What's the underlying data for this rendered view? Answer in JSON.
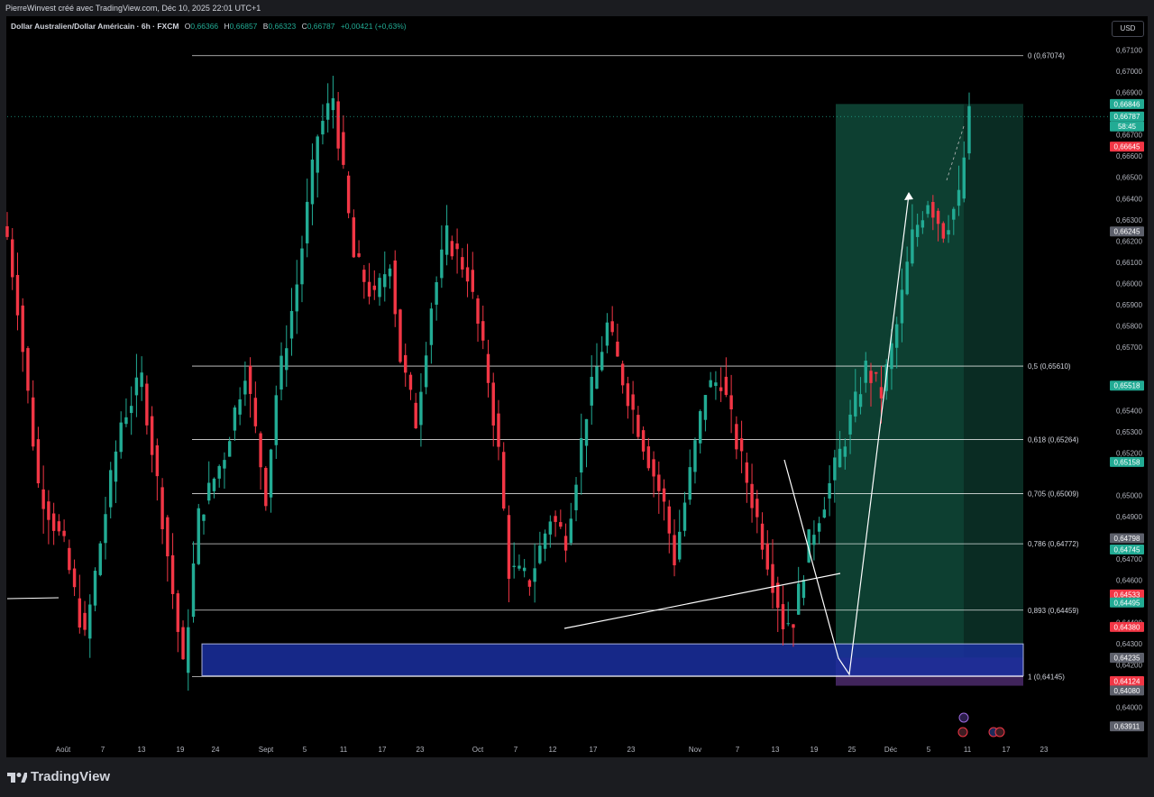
{
  "header": {
    "credit": "PierreWinvest créé avec TradingView.com, Déc 10, 2025 22:01 UTC+1"
  },
  "legend": {
    "symbol": "Dollar Australien/Dollar Américain · 6h · FXCM",
    "o_label": "O",
    "o": "0,66366",
    "h_label": "H",
    "h": "0,66857",
    "b_label": "B",
    "b": "0,66323",
    "c_label": "C",
    "c": "0,66787",
    "change": "+0,00421 (+0,63%)"
  },
  "currency_button": "USD",
  "brand": {
    "name": "TradingView"
  },
  "colors": {
    "up": "#22ab94",
    "down": "#f23645",
    "fib": "#ffffff",
    "zone_blue": "#1a2fa0",
    "profit": "#0f4a3a"
  },
  "chart_data": {
    "type": "candlestick",
    "symbol": "AUD/USD",
    "timeframe": "6h",
    "ylim": [
      0.6385,
      0.6726
    ],
    "y_ticks": [
      "0,67100",
      "0,67000",
      "0,66900",
      "0,66700",
      "0,66600",
      "0,66500",
      "0,66400",
      "0,66300",
      "0,66200",
      "0,66100",
      "0,66000",
      "0,65900",
      "0,65800",
      "0,65700",
      "0,65400",
      "0,65300",
      "0,65200",
      "0,65000",
      "0,64900",
      "0,64700",
      "0,64600",
      "0,64400",
      "0,64300",
      "0,64200",
      "0,64000"
    ],
    "x_ticks": [
      "Août",
      "7",
      "13",
      "19",
      "24",
      "Sept",
      "5",
      "11",
      "17",
      "23",
      "Oct",
      "7",
      "12",
      "17",
      "23",
      "Nov",
      "7",
      "13",
      "19",
      "25",
      "Déc",
      "5",
      "11",
      "17",
      "23"
    ],
    "price_path": [
      [
        0,
        0.6622
      ],
      [
        2,
        0.659
      ],
      [
        6,
        0.6505
      ],
      [
        11,
        0.6475
      ],
      [
        15,
        0.6432
      ],
      [
        18,
        0.6478
      ],
      [
        22,
        0.6535
      ],
      [
        26,
        0.6555
      ],
      [
        30,
        0.649
      ],
      [
        34,
        0.6418
      ],
      [
        37,
        0.649
      ],
      [
        42,
        0.652
      ],
      [
        46,
        0.656
      ],
      [
        50,
        0.65
      ],
      [
        52,
        0.6548
      ],
      [
        56,
        0.66
      ],
      [
        60,
        0.667
      ],
      [
        63,
        0.6688
      ],
      [
        67,
        0.6612
      ],
      [
        71,
        0.6592
      ],
      [
        74,
        0.6612
      ],
      [
        76,
        0.6565
      ],
      [
        79,
        0.6535
      ],
      [
        82,
        0.659
      ],
      [
        85,
        0.6622
      ],
      [
        89,
        0.6605
      ],
      [
        93,
        0.6555
      ],
      [
        95,
        0.652
      ],
      [
        97,
        0.6465
      ],
      [
        101,
        0.646
      ],
      [
        105,
        0.649
      ],
      [
        108,
        0.648
      ],
      [
        112,
        0.654
      ],
      [
        116,
        0.658
      ],
      [
        119,
        0.6555
      ],
      [
        123,
        0.6525
      ],
      [
        127,
        0.6495
      ],
      [
        129,
        0.647
      ],
      [
        132,
        0.651
      ],
      [
        135,
        0.655
      ],
      [
        138,
        0.6555
      ],
      [
        141,
        0.6525
      ],
      [
        144,
        0.6498
      ],
      [
        147,
        0.647
      ],
      [
        150,
        0.644
      ],
      [
        152,
        0.6442
      ],
      [
        155,
        0.6478
      ],
      [
        159,
        0.6505
      ],
      [
        163,
        0.6535
      ],
      [
        166,
        0.656
      ],
      [
        169,
        0.6548
      ],
      [
        172,
        0.658
      ],
      [
        175,
        0.6622
      ],
      [
        178,
        0.664
      ],
      [
        181,
        0.6625
      ],
      [
        184,
        0.664
      ],
      [
        186,
        0.66787
      ]
    ],
    "fibonacci": [
      {
        "level": "0 (0,67074)",
        "price": 0.67074
      },
      {
        "level": "0,5 (0,65610)",
        "price": 0.6561
      },
      {
        "level": "0,618 (0,65264)",
        "price": 0.65264
      },
      {
        "level": "0,705 (0,65009)",
        "price": 0.65009
      },
      {
        "level": "0,786 (0,64772)",
        "price": 0.64772
      },
      {
        "level": "0,893 (0,64459)",
        "price": 0.64459
      },
      {
        "level": "1 (0,64145)",
        "price": 0.64145
      }
    ],
    "demand_zone": {
      "top": 0.643,
      "bottom": 0.6415
    },
    "long_position": {
      "entry": 0.64235,
      "target": 0.66846,
      "stop": 0.64124
    },
    "current_price": 0.66787,
    "countdown": "58:45",
    "price_labels": [
      {
        "text": "0,66846",
        "price": 0.66846,
        "color": "#22ab94"
      },
      {
        "text": "0,66787",
        "price": 0.66787,
        "color": "#22ab94"
      },
      {
        "text": "0,66645",
        "price": 0.66645,
        "color": "#f23645"
      },
      {
        "text": "0,66245",
        "price": 0.66245,
        "color": "#5d606b"
      },
      {
        "text": "0,65518",
        "price": 0.65518,
        "color": "#22ab94"
      },
      {
        "text": "0,65158",
        "price": 0.65158,
        "color": "#22ab94"
      },
      {
        "text": "0,64798",
        "price": 0.64798,
        "color": "#5d606b"
      },
      {
        "text": "0,64745",
        "price": 0.64745,
        "color": "#22ab94"
      },
      {
        "text": "0,64533",
        "price": 0.64533,
        "color": "#f23645"
      },
      {
        "text": "0,64495",
        "price": 0.64495,
        "color": "#22ab94"
      },
      {
        "text": "0,64380",
        "price": 0.6438,
        "color": "#f23645"
      },
      {
        "text": "0,64235",
        "price": 0.64235,
        "color": "#5d606b"
      },
      {
        "text": "0,64124",
        "price": 0.64124,
        "color": "#f23645"
      },
      {
        "text": "0,64080",
        "price": 0.6408,
        "color": "#5d606b"
      },
      {
        "text": "0,63911",
        "price": 0.63911,
        "color": "#5d606b"
      }
    ]
  }
}
